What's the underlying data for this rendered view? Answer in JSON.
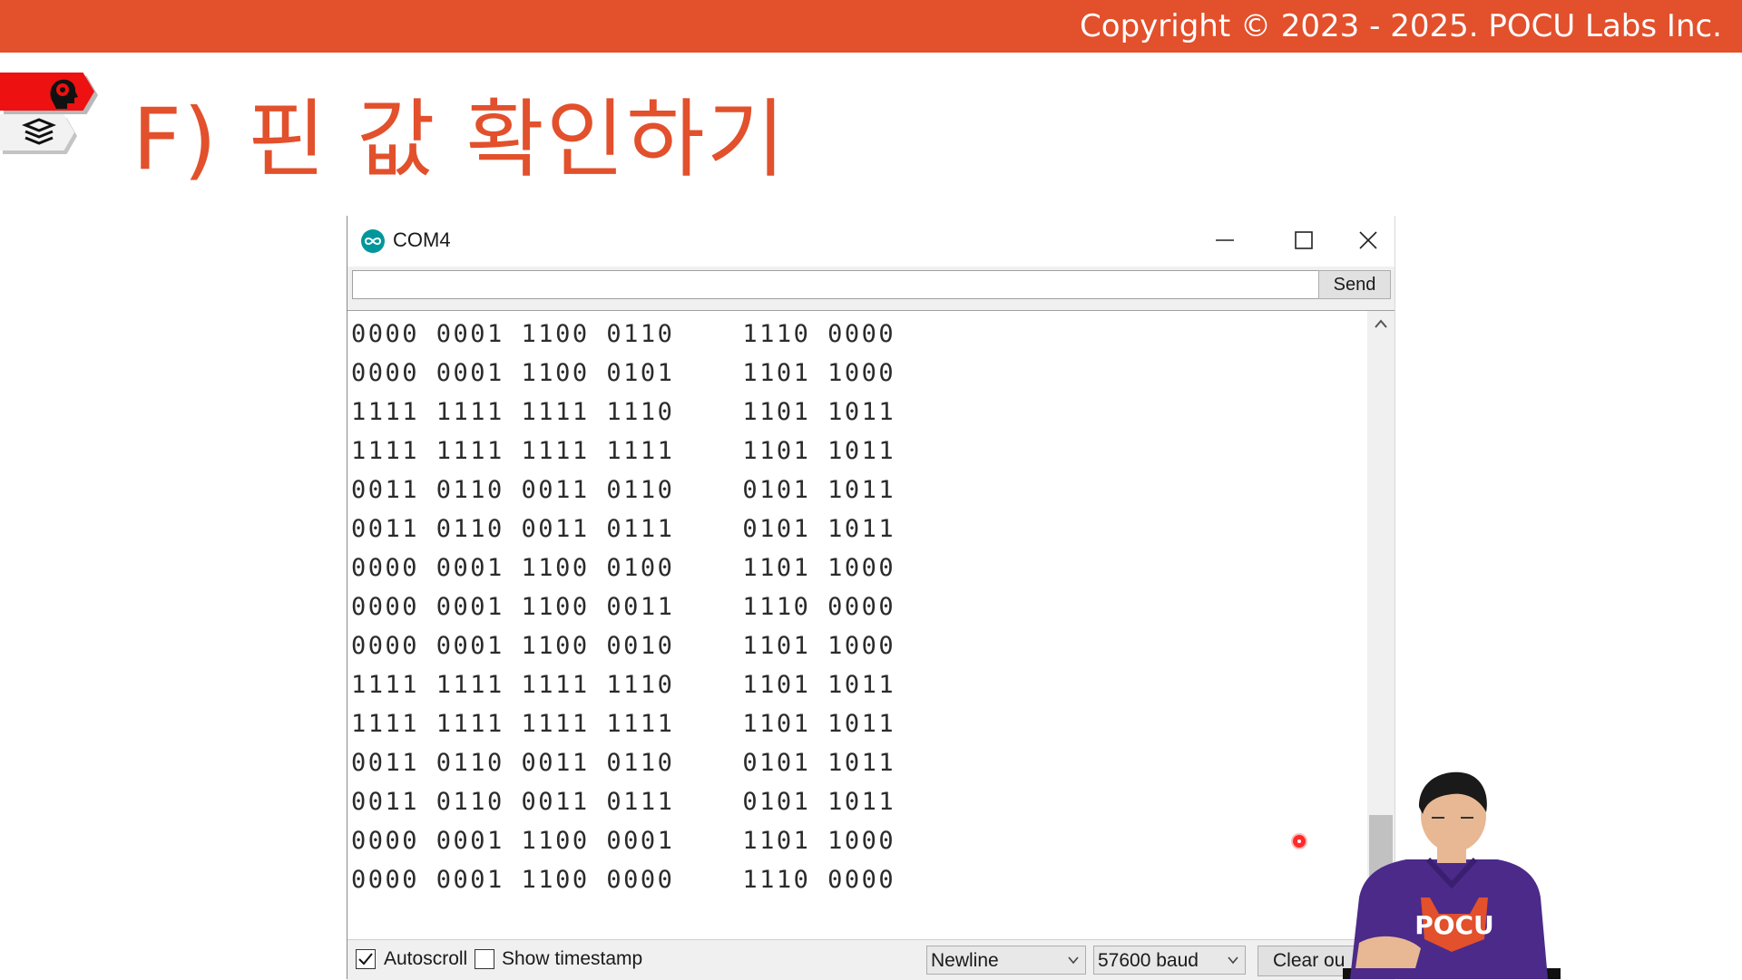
{
  "header": {
    "copyright": "Copyright © 2023 - 2025. POCU Labs Inc."
  },
  "slide": {
    "title": "F) 핀 값 확인하기"
  },
  "colors": {
    "brand": "#e2502c",
    "tag_red": "#ee1111",
    "arduino_teal": "#00979c"
  },
  "window": {
    "title": "COM4",
    "app_icon": "arduino-icon",
    "input_value": "",
    "send_label": "Send",
    "output_lines": [
      "0000 0001 1100 0110    1110 0000",
      "0000 0001 1100 0101    1101 1000",
      "1111 1111 1111 1110    1101 1011",
      "1111 1111 1111 1111    1101 1011",
      "0011 0110 0011 0110    0101 1011",
      "0011 0110 0011 0111    0101 1011",
      "0000 0001 1100 0100    1101 1000",
      "0000 0001 1100 0011    1110 0000",
      "0000 0001 1100 0010    1101 1000",
      "1111 1111 1111 1110    1101 1011",
      "1111 1111 1111 1111    1101 1011",
      "0011 0110 0011 0110    0101 1011",
      "0011 0110 0011 0111    0101 1011",
      "0000 0001 1100 0001    1101 1000",
      "0000 0001 1100 0000    1110 0000"
    ],
    "autoscroll_label": "Autoscroll",
    "autoscroll_checked": true,
    "timestamp_label": "Show timestamp",
    "timestamp_checked": false,
    "line_ending": "Newline",
    "baud_rate": "57600 baud",
    "clear_label": "Clear ou"
  },
  "presenter": {
    "shirt_text": "POCU"
  }
}
